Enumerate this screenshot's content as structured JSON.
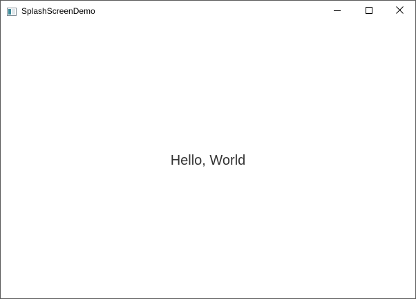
{
  "window": {
    "title": "SplashScreenDemo",
    "app_icon": "window-app-icon",
    "controls": {
      "minimize_icon": "minimize-icon",
      "maximize_icon": "maximize-icon",
      "close_icon": "close-icon"
    }
  },
  "content": {
    "message": "Hello, World"
  },
  "colors": {
    "border": "#5a5a5a",
    "background": "#ffffff",
    "text": "#333333"
  }
}
